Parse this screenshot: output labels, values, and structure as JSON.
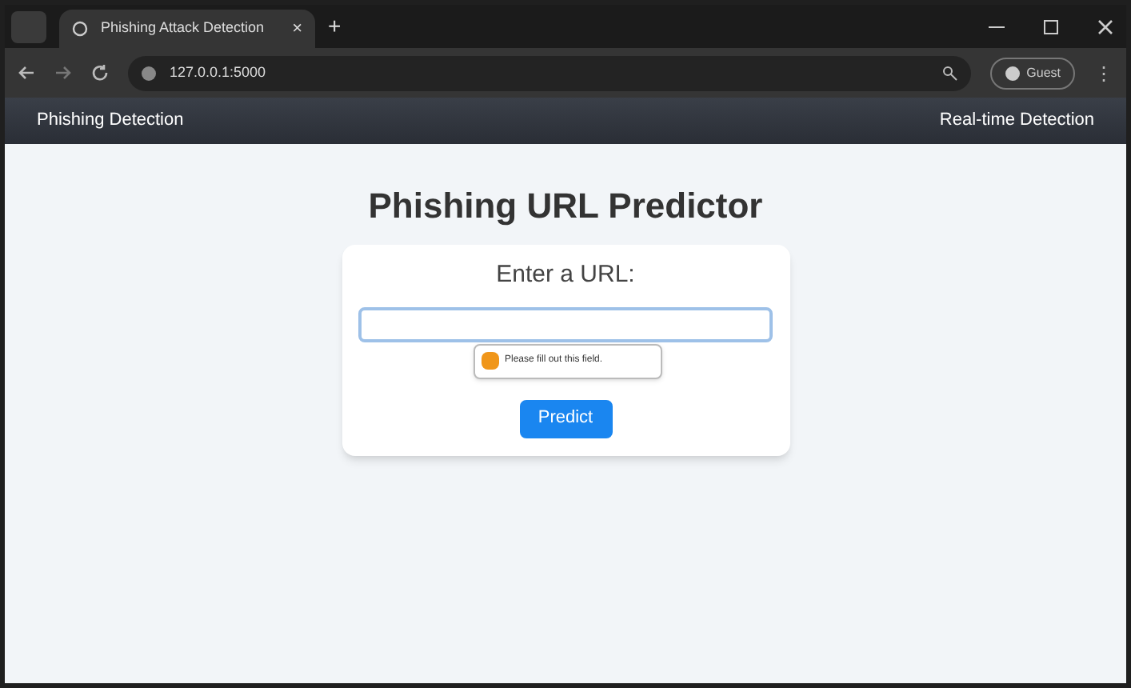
{
  "browser": {
    "tab_title": "Phishing Attack Detection",
    "tab_close": "×",
    "new_tab": "+",
    "address": "127.0.0.1:5000",
    "profile": "Guest",
    "menu": "⋮"
  },
  "navbar": {
    "brand": "Phishing Detection",
    "link": "Real-time Detection"
  },
  "main": {
    "heading": "Phishing URL Predictor",
    "label": "Enter a URL:",
    "tooltip": "Please fill out this field.",
    "button": "Predict"
  }
}
